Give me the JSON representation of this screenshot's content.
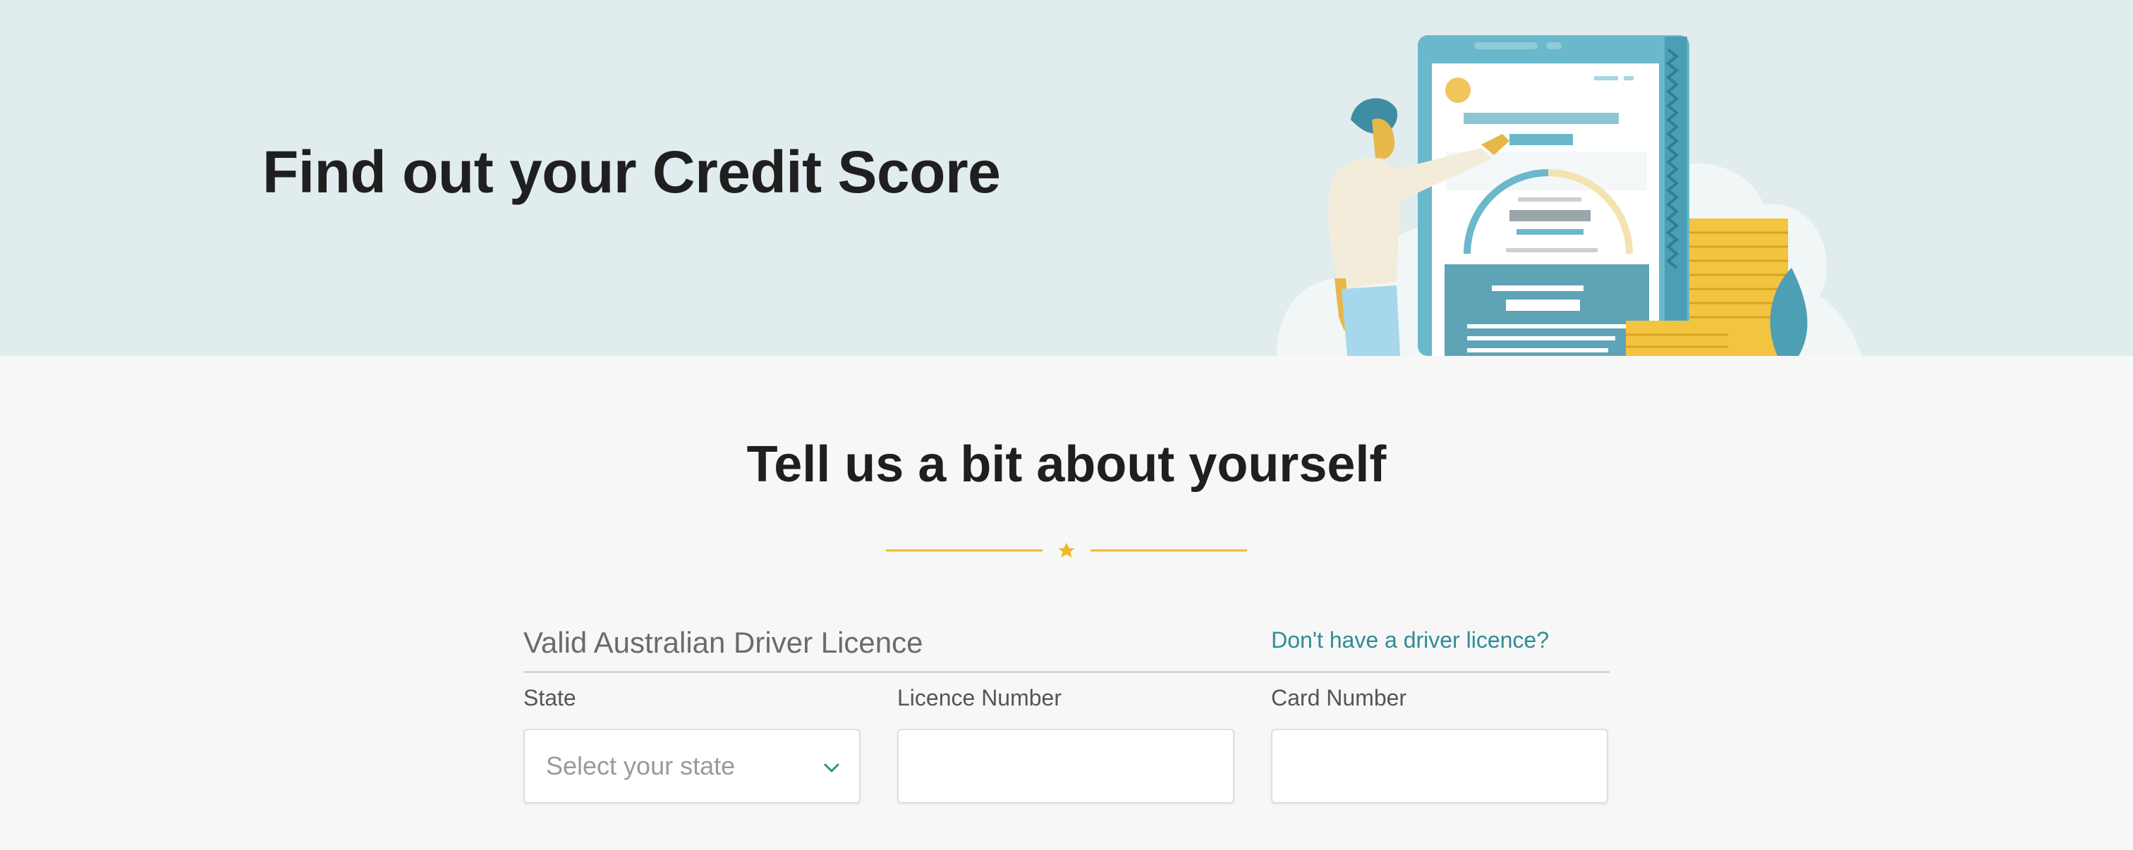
{
  "hero": {
    "title": "Find out your Credit Score"
  },
  "section": {
    "title": "Tell us a bit about yourself"
  },
  "form": {
    "group_title": "Valid Australian Driver Licence",
    "no_licence_link": "Don't have a driver licence?",
    "fields": {
      "state": {
        "label": "State",
        "placeholder": "Select your state"
      },
      "licence_number": {
        "label": "Licence Number",
        "value": ""
      },
      "card_number": {
        "label": "Card Number",
        "value": ""
      }
    }
  },
  "colors": {
    "hero_bg": "#e0eced",
    "page_bg": "#f7f7f7",
    "accent_gold": "#f0b82d",
    "link_teal": "#2f8c96"
  },
  "icons": {
    "divider": "star-icon",
    "select": "chevron-down-icon"
  }
}
